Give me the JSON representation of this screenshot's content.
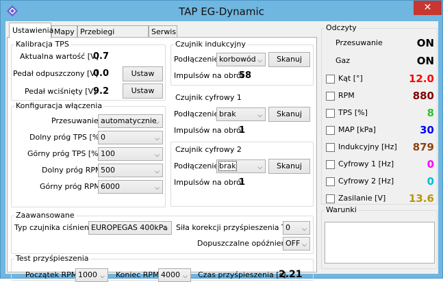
{
  "window": {
    "title": "TAP EG-Dynamic",
    "close_symbol": "✕",
    "icon": "app-diamond-icon"
  },
  "tabs": [
    "Ustawienia",
    "Mapy",
    "Przebiegi sygnałów",
    "Serwis"
  ],
  "kalibracja": {
    "title": "Kalibracja TPS",
    "aktualna_label": "Aktualna wartość [V]",
    "aktualna_value": "0.7",
    "odpuszczony_label": "Pedał odpuszczony [V]",
    "odpuszczony_value": "0.0",
    "wcisniety_label": "Pedał wciśnięty [V]",
    "wcisniety_value": "9.2",
    "ustaw": "Ustaw"
  },
  "konfiguracja": {
    "title": "Konfiguracja włączenia",
    "przesuwanie_label": "Przesuwanie",
    "przesuwanie_value": "automatycznie",
    "dolny_tps_label": "Dolny próg TPS [%]",
    "dolny_tps_value": "0",
    "gorny_tps_label": "Górny próg TPS [%]",
    "gorny_tps_value": "100",
    "dolny_rpm_label": "Dolny próg RPM",
    "dolny_rpm_value": "500",
    "gorny_rpm_label": "Górny próg RPM",
    "gorny_rpm_value": "6000"
  },
  "czujnik_ind": {
    "title": "Czujnik indukcyjny",
    "podlaczenie_label": "Podłączenie",
    "podlaczenie_value": "korbowód",
    "skanuj": "Skanuj",
    "impulsow_label": "Impulsów na obrót",
    "impulsow_value": "58"
  },
  "czujnik_c1": {
    "title": "Czujnik cyfrowy 1",
    "podlaczenie_label": "Podłączenie",
    "podlaczenie_value": "brak",
    "skanuj": "Skanuj",
    "impulsow_label": "Impulsów na obrót",
    "impulsow_value": "1"
  },
  "czujnik_c2": {
    "title": "Czujnik cyfrowy 2",
    "podlaczenie_label": "Podłączenie",
    "podlaczenie_value": "brak",
    "skanuj": "Skanuj",
    "impulsow_label": "Impulsów na obrót",
    "impulsow_value": "1"
  },
  "zaawansowane": {
    "title": "Zaawansowane",
    "typ_label": "Typ czujnika ciśnienia",
    "typ_value": "EUROPEGAS 400kPa",
    "sila_label": "Siła korekcji przyśpieszenia TPS",
    "sila_value": "0",
    "opoznienie_label": "Dopuszczalne opóźnienie",
    "opoznienie_value": "OFF"
  },
  "test": {
    "title": "Test przyśpieszenia",
    "poczatek_label": "Początek RPM",
    "poczatek_value": "1000",
    "koniec_label": "Koniec RPM",
    "koniec_value": "4000",
    "czas_label": "Czas przyśpieszenia [s]",
    "czas_value": "2.21"
  },
  "odczyty": {
    "title": "Odczyty",
    "przesuwanie_label": "Przesuwanie",
    "przesuwanie_value": "ON",
    "gaz_label": "Gaz",
    "gaz_value": "ON",
    "items": [
      {
        "label": "Kąt [°]",
        "value": "12.0",
        "color": "#ff0000"
      },
      {
        "label": "RPM",
        "value": "880",
        "color": "#800000"
      },
      {
        "label": "TPS [%]",
        "value": "8",
        "color": "#2bc42b"
      },
      {
        "label": "MAP [kPa]",
        "value": "30",
        "color": "#0000ff"
      },
      {
        "label": "Indukcyjny [Hz]",
        "value": "879",
        "color": "#8b4513"
      },
      {
        "label": "Cyfrowy 1 [Hz]",
        "value": "0",
        "color": "#ff00ff"
      },
      {
        "label": "Cyfrowy 2 [Hz]",
        "value": "0",
        "color": "#00bcd4"
      },
      {
        "label": "Zasilanie [V]",
        "value": "13.6",
        "color": "#b8960b"
      }
    ]
  },
  "warunki": {
    "title": "Warunki"
  }
}
